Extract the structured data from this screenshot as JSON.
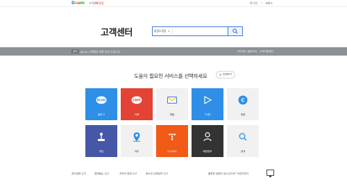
{
  "topbar": {
    "logo": {
      "d": "D",
      "a": "a",
      "u": "u",
      "m": "m"
    },
    "service": "고객센터",
    "badge": "N 알림",
    "user": "로그인",
    "more": "서비스"
  },
  "header": {
    "title": "고객센터",
    "search_scope": "통합도움말",
    "search_value": ""
  },
  "notice": {
    "badge": "공지",
    "text": "Daum 고객센터 개편 안내 드립니다",
    "right": [
      "자주하는 질문",
      "FAQ",
      "고객지원센터"
    ]
  },
  "main": {
    "headline": "도움이 필요한 서비스를 선택하세요",
    "all_services": "전체보기",
    "tiles": [
      {
        "label": "블로그",
        "icon": "blog-icon",
        "icon_text": "BLOG",
        "bg": "#2e8fe7",
        "fg": "#ffffff"
      },
      {
        "label": "카페",
        "icon": "cafe-icon",
        "icon_text": "CAFE",
        "bg": "#e34235",
        "fg": "#ffffff"
      },
      {
        "label": "메일",
        "icon": "mail-icon",
        "icon_text": "",
        "bg": "#f1f1f1",
        "fg": "#333333"
      },
      {
        "label": "TV팟",
        "icon": "play-icon",
        "icon_text": "",
        "bg": "#2f8fe6",
        "fg": "#ffffff"
      },
      {
        "label": "계정",
        "icon": "account-c-icon",
        "icon_text": "C",
        "bg": "#f1f1f1",
        "fg": "#333333"
      },
      {
        "label": "게임",
        "icon": "joystick-icon",
        "icon_text": "",
        "bg": "#4657a8",
        "fg": "#ffffff"
      },
      {
        "label": "지도",
        "icon": "map-pin-icon",
        "icon_text": "",
        "bg": "#f1f1f1",
        "fg": "#333333"
      },
      {
        "label": "티스토리",
        "icon": "tistory-icon",
        "icon_text": "",
        "bg": "#f25a17",
        "fg": "#ffffff"
      },
      {
        "label": "회원정보",
        "icon": "user-icon",
        "icon_text": "",
        "bg": "#333333",
        "fg": "#ffffff"
      },
      {
        "label": "검색",
        "icon": "search-icon",
        "icon_text": "",
        "bg": "#f1f1f1",
        "fg": "#333333"
      }
    ]
  },
  "footer": {
    "links": [
      "권리침해 신고",
      "명예훼손 신고",
      "저작권 침해 신고",
      "청소년 유해정보 신고"
    ],
    "right_text": "불편한 경험이 있으신가요? 의견보내기"
  },
  "colors": {
    "accent": "#3f79d6",
    "notice_bar": "#8c9196"
  }
}
